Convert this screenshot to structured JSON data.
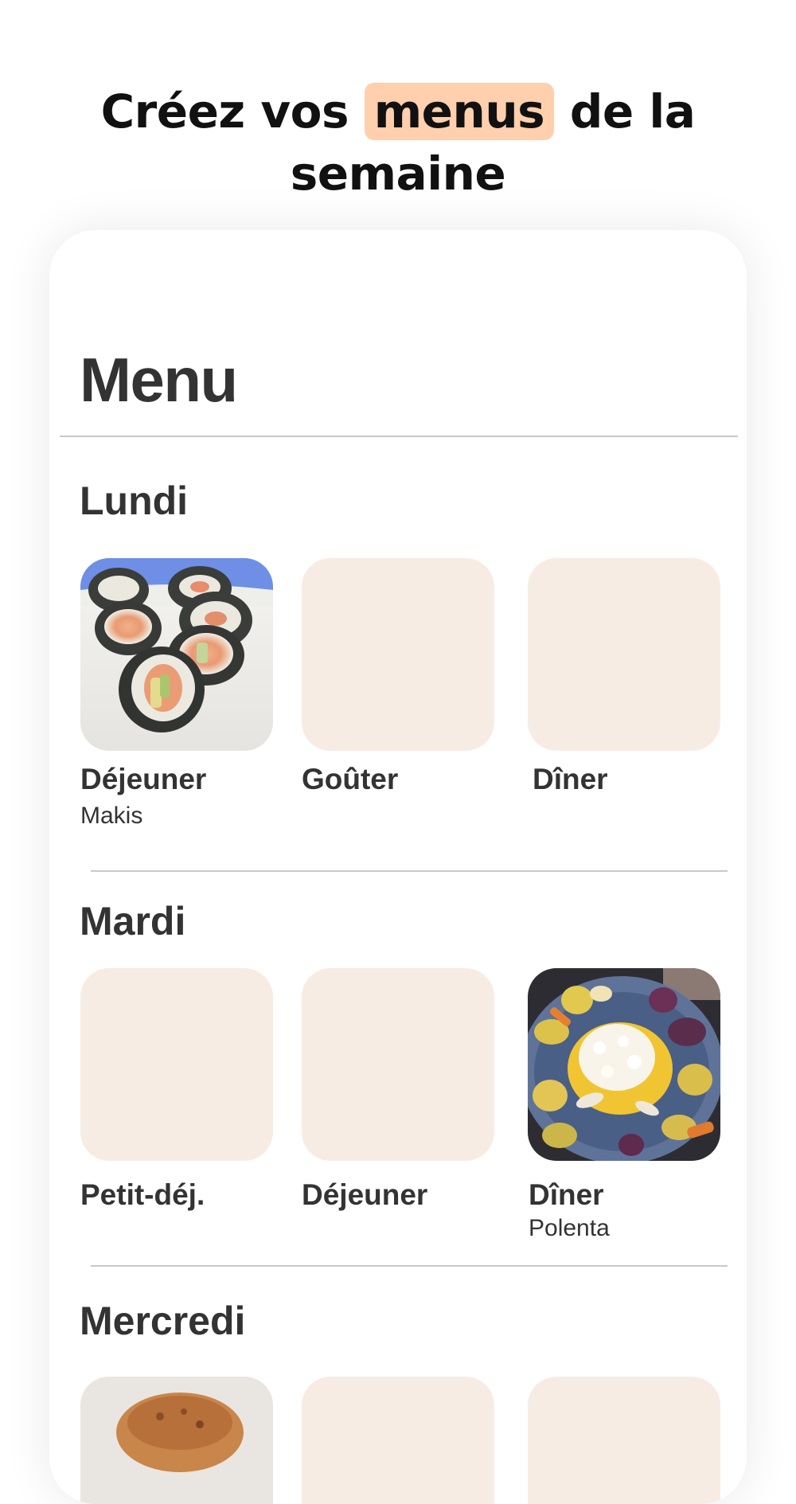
{
  "headline": {
    "before": "Créez vos ",
    "highlight": "menus",
    "after": " de la semaine"
  },
  "menu": {
    "title": "Menu"
  },
  "days": {
    "monday": {
      "name": "Lundi",
      "meals": [
        {
          "label": "Déjeuner",
          "dish": "Makis",
          "image": "makis-photo"
        },
        {
          "label": "Goûter",
          "dish": "",
          "image": ""
        },
        {
          "label": "Dîner",
          "dish": "",
          "image": ""
        }
      ]
    },
    "tuesday": {
      "name": "Mardi",
      "meals": [
        {
          "label": "Petit-déj.",
          "dish": "",
          "image": ""
        },
        {
          "label": "Déjeuner",
          "dish": "",
          "image": ""
        },
        {
          "label": "Dîner",
          "dish": "Polenta",
          "image": "polenta-photo"
        }
      ]
    },
    "wednesday": {
      "name": "Mercredi",
      "meals": [
        {
          "label": "",
          "dish": "",
          "image": "baked-dish-photo"
        },
        {
          "label": "",
          "dish": "",
          "image": ""
        },
        {
          "label": "",
          "dish": "",
          "image": ""
        }
      ]
    }
  },
  "colors": {
    "highlight": "#ffcfae",
    "empty_tile": "#f7ece4",
    "text": "#333333",
    "divider": "#c9c9c9"
  }
}
